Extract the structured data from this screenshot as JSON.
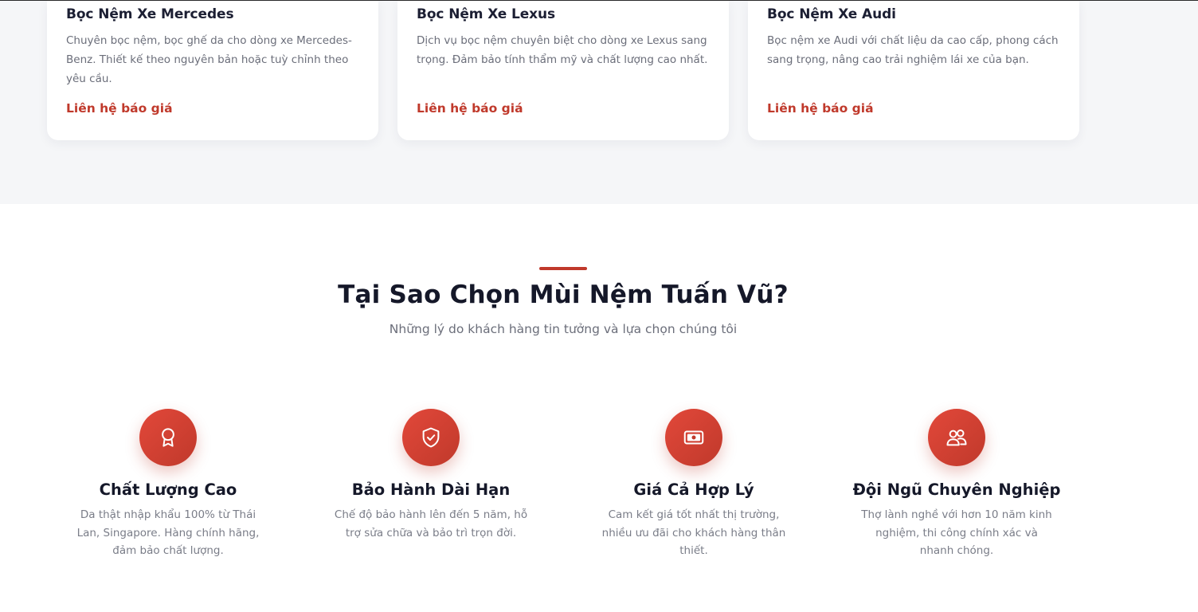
{
  "services": [
    {
      "title": "Bọc Nệm Xe Mercedes",
      "description": "Chuyên bọc nệm, bọc ghế da cho dòng xe Mercedes-Benz. Thiết kế theo nguyên bản hoặc tuỳ chỉnh theo yêu cầu.",
      "link": "Liên hệ báo giá"
    },
    {
      "title": "Bọc Nệm Xe Lexus",
      "description": "Dịch vụ bọc nệm chuyên biệt cho dòng xe Lexus sang trọng. Đảm bảo tính thẩm mỹ và chất lượng cao nhất.",
      "link": "Liên hệ báo giá"
    },
    {
      "title": "Bọc Nệm Xe Audi",
      "description": "Bọc nệm xe Audi với chất liệu da cao cấp, phong cách sang trọng, nâng cao trải nghiệm lái xe của bạn.",
      "link": "Liên hệ báo giá"
    }
  ],
  "why": {
    "title": "Tại Sao Chọn Mùi Nệm Tuấn Vũ?",
    "subtitle": "Những lý do khách hàng tin tưởng và lựa chọn chúng tôi",
    "features": [
      {
        "icon": "award-icon",
        "title": "Chất Lượng Cao",
        "description": "Da thật nhập khẩu 100% từ Thái Lan, Singapore. Hàng chính hãng, đảm bảo chất lượng."
      },
      {
        "icon": "shield-check-icon",
        "title": "Bảo Hành Dài Hạn",
        "description": "Chế độ bảo hành lên đến 5 năm, hỗ trợ sửa chữa và bảo trì trọn đời."
      },
      {
        "icon": "money-icon",
        "title": "Giá Cả Hợp Lý",
        "description": "Cam kết giá tốt nhất thị trường, nhiều ưu đãi cho khách hàng thân thiết."
      },
      {
        "icon": "users-icon",
        "title": "Đội Ngũ Chuyên Nghiệp",
        "description": "Thợ lành nghề với hơn 10 năm kinh nghiệm, thi công chính xác và nhanh chóng."
      }
    ]
  },
  "colors": {
    "accent": "#c0392b",
    "section_bg": "#f5f6f8",
    "heading": "#151829",
    "muted": "#6b6e7a"
  }
}
